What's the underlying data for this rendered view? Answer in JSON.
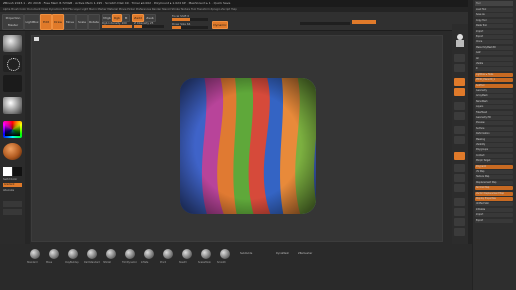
{
  "window": {
    "title": "ZBrush 2023.1 · ZC 2018 · Free Mem 8.723GB · Active Mem 1.195 · Scratch Disk 49 · Timer ▸0.002 · PolyCount ▸ 1.024 KP · MeshCount ▸ 1 · Quick Save"
  },
  "menu": {
    "items": "Alpha  Brush  Color  Document  Draw  Dynamics  Edit  File  Layer  Light  Macro  Marker  Material  Movie  Picker  Preferences  Render  Stencil  Stroke  Texture  Tool  Transform  Zplugin  Zscript  Help"
  },
  "toolbar": {
    "projection_master": "Projection Master",
    "lightbox": "LightBox",
    "edit": "Edit",
    "draw": "Draw",
    "move": "Move",
    "scale": "Scale",
    "rotate": "Rotate",
    "mrgb": "Mrgb",
    "rgb": "Rgb",
    "m": "M",
    "zadd": "Zadd",
    "zsub": "Zsub",
    "focal_shift_label": "Focal Shift 0",
    "draw_size_label": "Draw Size 64",
    "rgb_intensity_label": "Rgb Intensity 100",
    "z_intensity_label": "Z Intensity 25",
    "dynamic": "Dynamic",
    "focal_shift": 0,
    "draw_size": 64,
    "rgb_intensity": 100,
    "z_intensity": 25
  },
  "bottom": {
    "brushes": [
      "Standard",
      "Move",
      "ClayBuildup",
      "DamStandard",
      "hPolish",
      "TrimDynamic",
      "Inflate",
      "Pinch",
      "Slash3",
      "SnakeHook",
      "Smooth"
    ],
    "subtools_label": "Subdivide",
    "dynamesh_label": "DynaMesh",
    "zremesher_label": "ZRemesher"
  },
  "right_panel": {
    "header": "Tool",
    "items": [
      "Load Tool",
      "Save As",
      "Copy Tool",
      "Paste Tool",
      "Import",
      "Export",
      "Clone",
      "Make PolyMesh3D",
      "GoZ",
      "All",
      "Visible",
      "R",
      "Lightbox ▸ Tools",
      "PM3D_Plane3D_1",
      "SubTool",
      "Geometry",
      "ArrayMesh",
      "NanoMesh",
      "Layers",
      "FiberMesh",
      "Geometry HD",
      "Preview",
      "Surface",
      "Deformation",
      "Masking",
      "Visibility",
      "Polygroups",
      "Contact",
      "Morph Target",
      "Polypaint",
      "UV Map",
      "Texture Map",
      "Displacement Map",
      "Normal Map",
      "Vector Displacement Map",
      "Display Properties",
      "Unified Skin",
      "Initialize",
      "Import",
      "Export"
    ]
  },
  "left": {
    "color_label": "SwitchColor",
    "gradient_label": "Gradient",
    "alternate_label": "Alternate"
  },
  "canvas": {
    "stripe_colors": [
      "#3f63c8",
      "#b8449a",
      "#e07a32",
      "#5fa83a",
      "#d64a3a",
      "#3464c4",
      "#e88a3a",
      "#7cb040"
    ]
  }
}
